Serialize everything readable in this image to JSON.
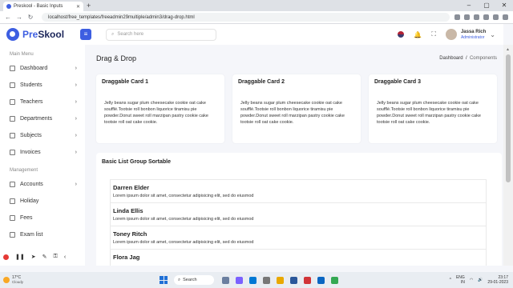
{
  "browser": {
    "tab_title": "Preskool - Basic Inputs",
    "url": "localhost/free_templates/freeadmin29multiple/admin3/drag-drop.html"
  },
  "header": {
    "logo_pre": "Pre",
    "logo_post": "Skool",
    "search_placeholder": "Search here",
    "user_name": "Jassa Rich",
    "user_role": "Administrator"
  },
  "sidebar": {
    "main_menu_label": "Main Menu",
    "management_label": "Management",
    "main_items": [
      {
        "label": "Dashboard"
      },
      {
        "label": "Students"
      },
      {
        "label": "Teachers"
      },
      {
        "label": "Departments"
      },
      {
        "label": "Subjects"
      },
      {
        "label": "Invoices"
      }
    ],
    "mgmt_items": [
      {
        "label": "Accounts"
      },
      {
        "label": "Holiday"
      },
      {
        "label": "Fees"
      },
      {
        "label": "Exam list"
      }
    ]
  },
  "page": {
    "title": "Drag & Drop",
    "breadcrumb_parent": "Dashboard",
    "breadcrumb_current": "Components"
  },
  "cards": [
    {
      "title": "Draggable Card 1",
      "body": "Jelly beans sugar plum cheesecake cookie oat cake soufflé.Tootsie roll bonbon liquorice tiramisu pie powder.Donut sweet roll marzipan pastry cookie cake tootsie roll oat cake cookie."
    },
    {
      "title": "Draggable Card 2",
      "body": "Jelly beans sugar plum cheesecake cookie oat cake soufflé.Tootsie roll bonbon liquorice tiramisu pie powder.Donut sweet roll marzipan pastry cookie cake tootsie roll oat cake cookie."
    },
    {
      "title": "Draggable Card 3",
      "body": "Jelly beans sugar plum cheesecake cookie oat cake soufflé.Tootsie roll bonbon liquorice tiramisu pie powder.Donut sweet roll marzipan pastry cookie cake tootsie roll oat cake cookie."
    }
  ],
  "list_group": {
    "title": "Basic List Group Sortable",
    "items": [
      {
        "name": "Darren Elder",
        "desc": "Lorem ipsum dolor sit amet, consectetur adipisicing elit, sed do eiusmod"
      },
      {
        "name": "Linda Ellis",
        "desc": "Lorem ipsum dolor sit amet, consectetur adipisicing elit, sed do eiusmod"
      },
      {
        "name": "Toney Ritch",
        "desc": "Lorem ipsum dolor sit amet, consectetur adipisicing elit, sed do eiusmod"
      },
      {
        "name": "Flora Jag",
        "desc": ""
      }
    ]
  },
  "taskbar": {
    "temp": "17°C",
    "weather": "Cloudy",
    "search_label": "Search",
    "lang": "ENG",
    "region": "IN",
    "time": "23:17",
    "date": "29-01-2023"
  },
  "colors": {
    "accent": "#3d5ee1"
  }
}
